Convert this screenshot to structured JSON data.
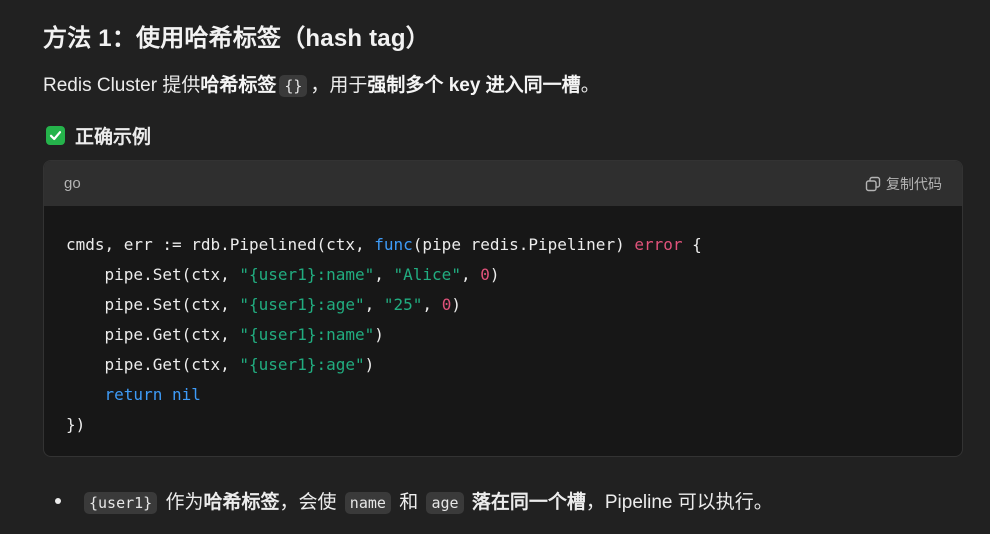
{
  "heading": "方法 1：使用哈希标签（hash tag）",
  "para": {
    "p1": "Redis Cluster 提供",
    "b1": "哈希标签",
    "code": "{}",
    "p2": "，用于",
    "b2": "强制多个 key 进入同一槽",
    "p3": "。"
  },
  "subheading": "正确示例",
  "codeblock": {
    "lang": "go",
    "copy_label": "复制代码",
    "lines": [
      [
        {
          "t": "cmds, err := rdb.Pipelined(ctx, ",
          "c": ""
        },
        {
          "t": "func",
          "c": "kw"
        },
        {
          "t": "(pipe redis.Pipeliner) ",
          "c": ""
        },
        {
          "t": "error",
          "c": "err"
        },
        {
          "t": " {",
          "c": ""
        }
      ],
      [
        {
          "t": "    pipe.Set(ctx, ",
          "c": ""
        },
        {
          "t": "\"{user1}:name\"",
          "c": "str"
        },
        {
          "t": ", ",
          "c": ""
        },
        {
          "t": "\"Alice\"",
          "c": "str"
        },
        {
          "t": ", ",
          "c": ""
        },
        {
          "t": "0",
          "c": "num"
        },
        {
          "t": ")",
          "c": ""
        }
      ],
      [
        {
          "t": "    pipe.Set(ctx, ",
          "c": ""
        },
        {
          "t": "\"{user1}:age\"",
          "c": "str"
        },
        {
          "t": ", ",
          "c": ""
        },
        {
          "t": "\"25\"",
          "c": "str"
        },
        {
          "t": ", ",
          "c": ""
        },
        {
          "t": "0",
          "c": "num"
        },
        {
          "t": ")",
          "c": ""
        }
      ],
      [
        {
          "t": "    pipe.Get(ctx, ",
          "c": ""
        },
        {
          "t": "\"{user1}:name\"",
          "c": "str"
        },
        {
          "t": ")",
          "c": ""
        }
      ],
      [
        {
          "t": "    pipe.Get(ctx, ",
          "c": ""
        },
        {
          "t": "\"{user1}:age\"",
          "c": "str"
        },
        {
          "t": ")",
          "c": ""
        }
      ],
      [
        {
          "t": "    ",
          "c": ""
        },
        {
          "t": "return",
          "c": "kw"
        },
        {
          "t": " ",
          "c": ""
        },
        {
          "t": "nil",
          "c": "kw"
        }
      ],
      [
        {
          "t": "})",
          "c": ""
        }
      ]
    ]
  },
  "bullet": {
    "code1": "{user1}",
    "t1": " 作为",
    "b1": "哈希标签",
    "t2": "，会使 ",
    "code2": "name",
    "t3": " 和 ",
    "code3": "age",
    "t4": " ",
    "b2": "落在同一个槽",
    "t5": "，Pipeline 可以执行。"
  },
  "colors": {
    "keyword": "#3e9bf7",
    "string": "#21ad80",
    "number": "#e0527a",
    "check": "#25b34b"
  }
}
